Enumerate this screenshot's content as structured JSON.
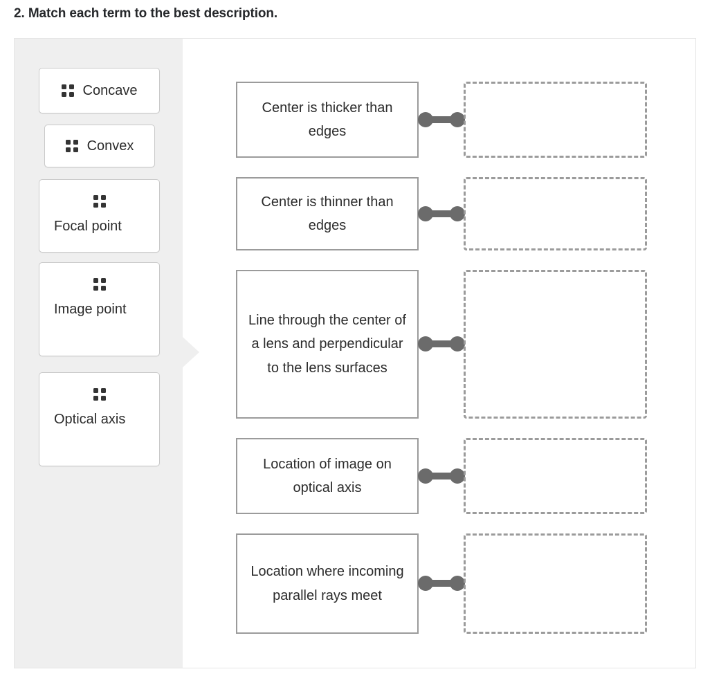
{
  "question": {
    "number": "2.",
    "title": "2. Match each term to the best description."
  },
  "colors": {
    "panel_background": "#efefef",
    "card_border": "#c9c9c9",
    "description_border": "#9b9b9b",
    "dropzone_border": "#9b9b9b",
    "connector": "#6b6b6b",
    "handle_dot": "#343434",
    "text": "#2b2b2b"
  },
  "terms_panel": {
    "handle_icon": "drag-handle-icon",
    "items": [
      {
        "label": "Concave",
        "layout": "inline"
      },
      {
        "label": "Convex",
        "layout": "inline"
      },
      {
        "label": "Focal point",
        "layout": "stacked"
      },
      {
        "label": "Image point",
        "layout": "stacked"
      },
      {
        "label": "Optical axis",
        "layout": "stacked"
      }
    ]
  },
  "match_area": {
    "connector_icon": "dumbbell-connector-icon",
    "rows": [
      {
        "description": "Center is thicker than edges",
        "answer": ""
      },
      {
        "description": "Center is thinner than edges",
        "answer": ""
      },
      {
        "description": "Line through the center of a lens and perpendicular to the lens surfaces",
        "answer": ""
      },
      {
        "description": "Location of image on optical axis",
        "answer": ""
      },
      {
        "description": "Location where incoming parallel rays meet",
        "answer": ""
      }
    ]
  }
}
